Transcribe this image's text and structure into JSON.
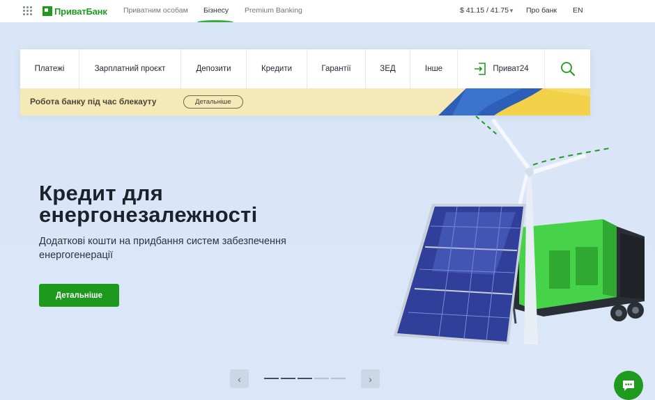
{
  "topbar": {
    "brand": "ПриватБанк",
    "nav": [
      "Приватним особам",
      "Бізнесу",
      "Premium Banking"
    ],
    "active_index": 1,
    "rate": "$ 41.15 / 41.75",
    "about": "Про банк",
    "lang": "EN"
  },
  "menu": {
    "items": [
      "Платежі",
      "Зарплатний проєкт",
      "Депозити",
      "Кредити",
      "Гарантії",
      "ЗЕД",
      "Інше"
    ],
    "privat24": "Приват24"
  },
  "notice": {
    "text": "Робота банку під час блекауту",
    "button": "Детальніше"
  },
  "hero": {
    "title_line1": "Кредит для",
    "title_line2": "енергонезалежності",
    "subtitle_line1": "Додаткові кошти на придбання систем забезпечення",
    "subtitle_line2": "енергогенерації",
    "cta": "Детальніше"
  },
  "pager": {
    "slides": 5,
    "active": 2
  },
  "colors": {
    "brand_green": "#1e9a1e",
    "background": "#d9e6f7",
    "notice_bg": "#f6e9b8"
  },
  "icons": {
    "apps": "grid-icon",
    "login": "login-arrow-icon",
    "search": "search-icon",
    "prev": "chevron-left-icon",
    "next": "chevron-right-icon",
    "chat": "chat-bubble-icon"
  }
}
